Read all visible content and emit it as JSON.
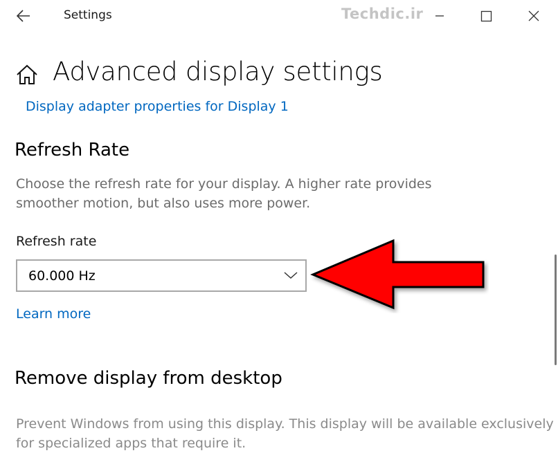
{
  "titlebar": {
    "app_title": "Settings",
    "watermark": "Techdic.ir",
    "icons": [
      "back-arrow-icon",
      "minimize-icon",
      "maximize-icon",
      "close-icon"
    ]
  },
  "header": {
    "icon": "home-icon",
    "title": "Advanced display settings",
    "adapter_link": "Display adapter properties for Display 1"
  },
  "refresh_section": {
    "heading": "Refresh Rate",
    "description": "Choose the refresh rate for your display. A higher rate provides smoother motion, but also uses more power.",
    "dropdown_label": "Refresh rate",
    "dropdown_value": "60.000 Hz",
    "learn_more": "Learn more"
  },
  "remove_section": {
    "heading": "Remove display from desktop",
    "description": "Prevent Windows from using this display. This display will be available exclusively for specialized apps that require it."
  },
  "colors": {
    "link": "#0067c0",
    "annotation_arrow": "#ff0000",
    "secondary_text": "#6b6b6b"
  }
}
